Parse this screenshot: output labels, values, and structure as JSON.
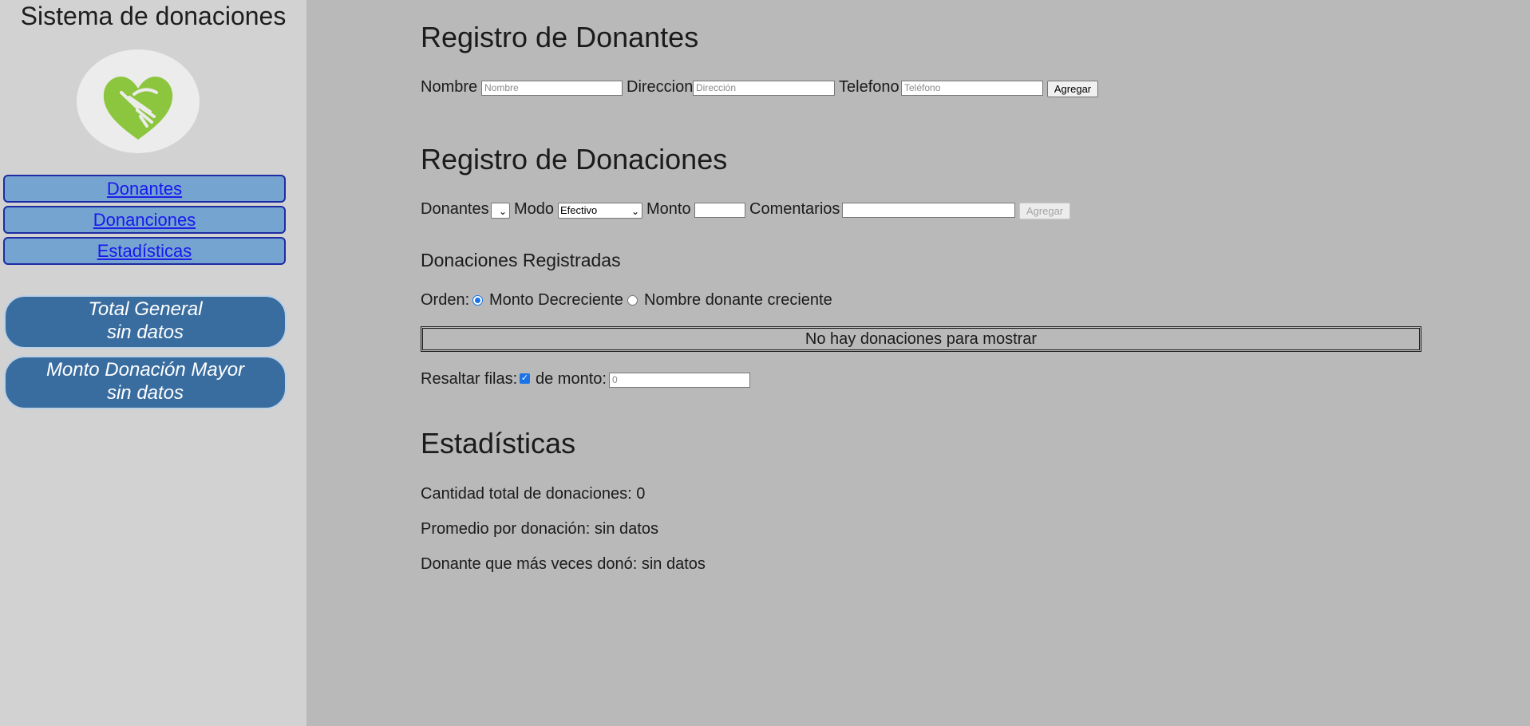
{
  "sidebar": {
    "app_title": "Sistema de donaciones",
    "nav": [
      {
        "label": "Donantes"
      },
      {
        "label": "Donanciones"
      },
      {
        "label": "Estadísticas"
      }
    ],
    "total_card": {
      "title": "Total General",
      "value": "sin datos"
    },
    "max_card": {
      "title": "Monto Donación Mayor",
      "value": "sin datos"
    }
  },
  "donantes": {
    "title": "Registro de Donantes",
    "nombre_label": "Nombre",
    "nombre_placeholder": "Nombre",
    "direccion_label": "Direccion",
    "direccion_placeholder": "Dirección",
    "telefono_label": "Telefono",
    "telefono_placeholder": "Teléfono",
    "add_button": "Agregar"
  },
  "donaciones": {
    "title": "Registro de Donaciones",
    "donantes_label": "Donantes",
    "modo_label": "Modo",
    "modo_value": "Efectivo",
    "monto_label": "Monto",
    "comentarios_label": "Comentarios",
    "add_button": "Agregar"
  },
  "registradas": {
    "title": "Donaciones Registradas",
    "orden_label": "Orden:",
    "orden_options": [
      "Monto Decreciente",
      "Nombre donante creciente"
    ],
    "orden_selected": "Monto Decreciente",
    "empty_message": "No hay donaciones para mostrar",
    "resaltar_label": "Resaltar filas:",
    "resaltar_checked": true,
    "de_monto_label": "de monto:",
    "monto_placeholder": "0"
  },
  "estadisticas": {
    "title": "Estadísticas",
    "cantidad": "Cantidad total de donaciones: 0",
    "promedio": "Promedio por donación: sin datos",
    "donante_mas": "Donante que más veces donó: sin datos"
  },
  "colors": {
    "page_bg": "#b9b9b9",
    "sidebar_bg": "#d2d2d2",
    "nav_bg": "#76a4d1",
    "card_bg": "#3a6d9f",
    "logo_green": "#8cc63f"
  },
  "icons": [
    "handshake-heart-icon",
    "chevron-down-icon"
  ]
}
